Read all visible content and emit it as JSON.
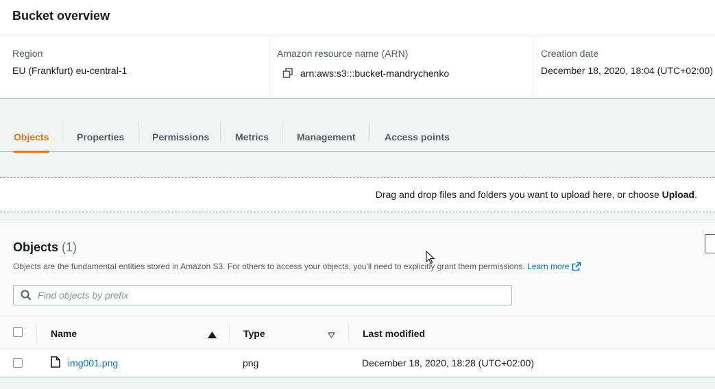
{
  "overview": {
    "title": "Bucket overview",
    "region_label": "Region",
    "region_value": "EU (Frankfurt) eu-central-1",
    "arn_label": "Amazon resource name (ARN)",
    "arn_value": "arn:aws:s3:::bucket-mandrychenko",
    "creation_label": "Creation date",
    "creation_value": "December 18, 2020, 18:04 (UTC+02:00)"
  },
  "tabs": [
    {
      "label": "Objects",
      "active": true
    },
    {
      "label": "Properties"
    },
    {
      "label": "Permissions"
    },
    {
      "label": "Metrics"
    },
    {
      "label": "Management"
    },
    {
      "label": "Access points"
    }
  ],
  "dropzone": {
    "text": "Drag and drop files and folders you want to upload here, or choose ",
    "action": "Upload",
    "suffix": "."
  },
  "objects": {
    "title": "Objects",
    "count": "(1)",
    "description": "Objects are the fundamental entities stored in Amazon S3. For others to access your objects, you'll need to explicitly grant them permissions.",
    "learn_more": "Learn more",
    "search_placeholder": "Find objects by prefix",
    "columns": {
      "name": "Name",
      "type": "Type",
      "last_modified": "Last modified"
    },
    "rows": [
      {
        "name": "img001.png",
        "type": "png",
        "last_modified": "December 18, 2020, 18:28 (UTC+02:00)"
      }
    ]
  },
  "colors": {
    "accent": "#ec7211",
    "link": "#0073bb",
    "text": "#16191f",
    "muted": "#545b64"
  }
}
